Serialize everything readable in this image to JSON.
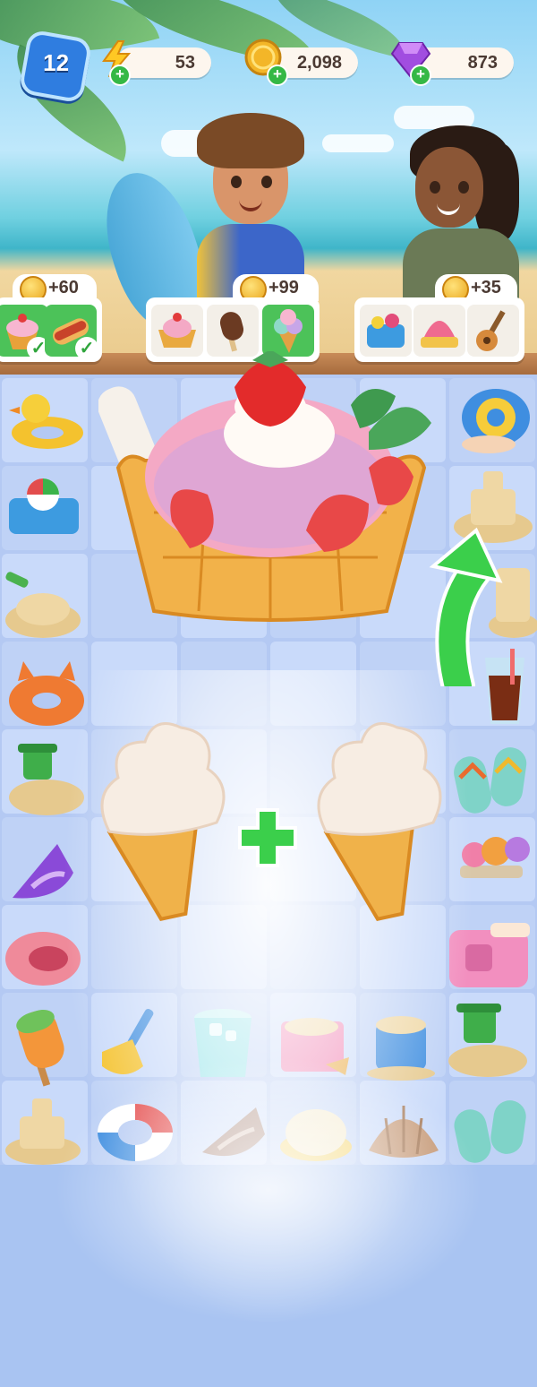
{
  "player": {
    "level": "12"
  },
  "resources": [
    {
      "name": "energy",
      "icon": "lightning-energy-icon",
      "value": "53"
    },
    {
      "name": "coins",
      "icon": "coin-icon",
      "value": "2,098"
    },
    {
      "name": "gems",
      "icon": "purple-gem-icon",
      "value": "873"
    }
  ],
  "orders": [
    {
      "reward": "+60",
      "items": [
        "cupcake-item",
        "hotdog-item"
      ],
      "completed": [
        true,
        true
      ]
    },
    {
      "reward": "+99",
      "items": [
        "waffle-bowl-sundae-item",
        "chocolate-popsicle-item",
        "ice-cream-scoops-item"
      ],
      "completed": [
        false,
        false,
        false
      ]
    },
    {
      "reward": "+35",
      "items": [
        "beach-basket-item",
        "seashell-toy-item",
        "ukulele-item"
      ],
      "completed": [
        false,
        false,
        false
      ]
    }
  ],
  "merge": {
    "input_item": "soft-serve-cone",
    "result_item": "strawberry-waffle-sundae",
    "operator": "plus-icon"
  },
  "colors": {
    "accent_green": "#3bcf4b",
    "board_bg": "#b4c9f3",
    "cell_bg": "#c4d6f8",
    "level_badge": "#2f7de0"
  }
}
